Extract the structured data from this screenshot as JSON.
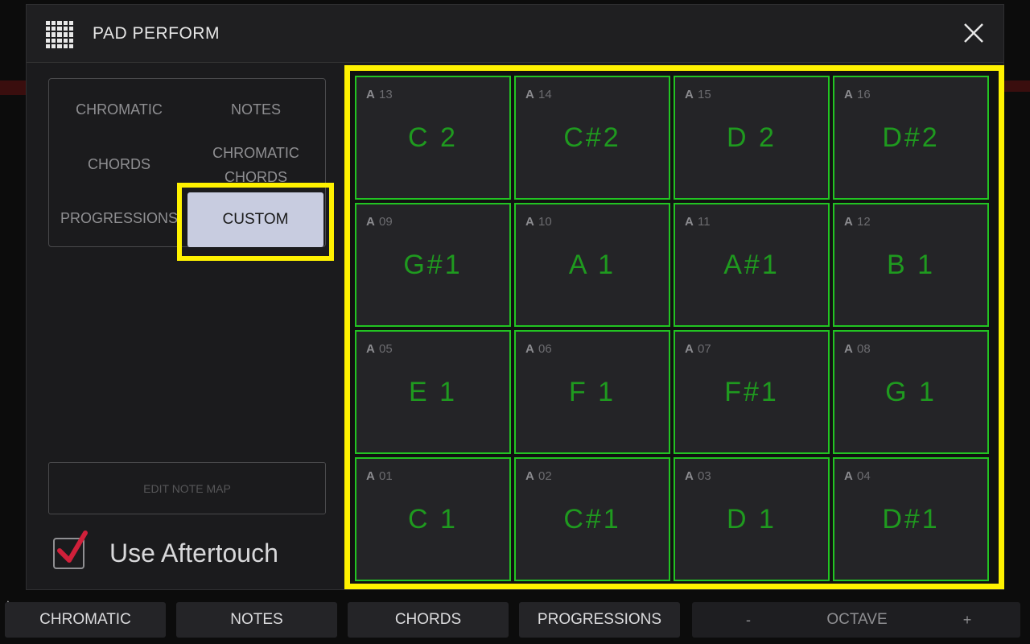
{
  "header": {
    "title": "PAD PERFORM",
    "icon": "pad-grid-icon",
    "close_icon": "close-icon"
  },
  "modes": {
    "chromatic": "CHROMATIC",
    "notes": "NOTES",
    "chords": "CHORDS",
    "chromatic_chords_1": "CHROMATIC",
    "chromatic_chords_2": "CHORDS",
    "progressions": "PROGRESSIONS",
    "custom": "CUSTOM",
    "selected": "CUSTOM"
  },
  "edit_note_map": "EDIT NOTE MAP",
  "aftertouch": {
    "label": "Use Aftertouch",
    "checked": true
  },
  "colors": {
    "highlight": "#fff200",
    "pad_border": "#22c422",
    "pad_note": "#1f9a1f",
    "check": "#d0203a"
  },
  "pads": [
    {
      "bank": "A",
      "num": "13",
      "note": "C 2"
    },
    {
      "bank": "A",
      "num": "14",
      "note": "C#2"
    },
    {
      "bank": "A",
      "num": "15",
      "note": "D 2"
    },
    {
      "bank": "A",
      "num": "16",
      "note": "D#2"
    },
    {
      "bank": "A",
      "num": "09",
      "note": "G#1"
    },
    {
      "bank": "A",
      "num": "10",
      "note": "A 1"
    },
    {
      "bank": "A",
      "num": "11",
      "note": "A#1"
    },
    {
      "bank": "A",
      "num": "12",
      "note": "B 1"
    },
    {
      "bank": "A",
      "num": "05",
      "note": "E 1"
    },
    {
      "bank": "A",
      "num": "06",
      "note": "F 1"
    },
    {
      "bank": "A",
      "num": "07",
      "note": "F#1"
    },
    {
      "bank": "A",
      "num": "08",
      "note": "G 1"
    },
    {
      "bank": "A",
      "num": "01",
      "note": "C 1"
    },
    {
      "bank": "A",
      "num": "02",
      "note": "C#1"
    },
    {
      "bank": "A",
      "num": "03",
      "note": "D 1"
    },
    {
      "bank": "A",
      "num": "04",
      "note": "D#1"
    }
  ],
  "bottom": {
    "chromatic": "CHROMATIC",
    "notes": "NOTES",
    "chords": "CHORDS",
    "progressions": "PROGRESSIONS",
    "octave_minus": "-",
    "octave_label": "OCTAVE",
    "octave_plus": "+"
  }
}
